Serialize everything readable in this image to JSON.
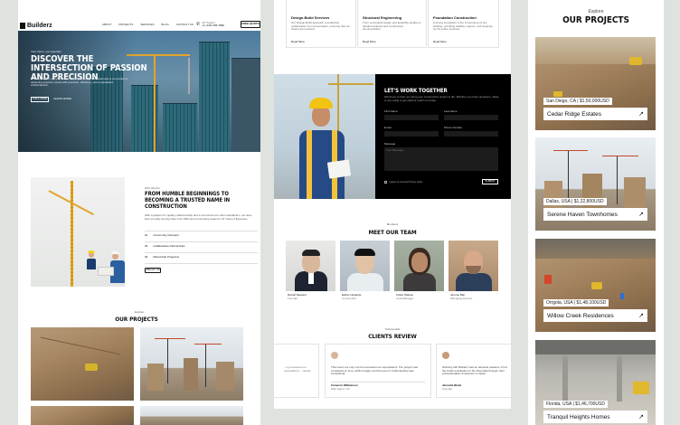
{
  "home": {
    "logo": "Builderz",
    "nav": [
      "ABOUT",
      "PROJECTS",
      "SERVICES",
      "BLOG",
      "CONTACT US"
    ],
    "support_label": "24/7 Support",
    "phone": "+1 (123) 456-7890",
    "cta": "FREE QUOTE",
    "hero": {
      "eyebrow": "Your vision, our expertise",
      "title": "DISCOVER THE INTERSECTION OF PASSION AND PRECISION",
      "desc": "From concept to completion, our dedicated team of professionals is committed to delivering superior results with precision, efficiency, and unparalleled craftsmanship.",
      "btn_primary": "CALL NOW",
      "btn_secondary": "LEARN MORE"
    },
    "about": {
      "eyebrow": "Who We Are",
      "title": "FROM HUMBLE BEGINNINGS TO BECOMING A TRUSTED NAME IN CONSTRUCTION",
      "desc": "With a passion for quality craftsmanship and a commitment to client satisfaction, we have been proudly serving New York 1026 and surrounding areas for 13 Years of Expertise.",
      "list": [
        {
          "num": "01",
          "label": "Community Outreach"
        },
        {
          "num": "02",
          "label": "Collaborative Partnerships"
        },
        {
          "num": "03",
          "label": "Mentorship Programs"
        }
      ],
      "btn": "ABOUT US"
    },
    "projects": {
      "eyebrow": "Explore",
      "title": "OUR PROJECTS"
    }
  },
  "services_page": {
    "services": [
      {
        "title": "Design-Build Services",
        "desc": "Our Design-Build approach emphasizes collaboration & communication, ensuring that our clients are involved.",
        "link": "Read More"
      },
      {
        "title": "Structural Engineering",
        "desc": "From conceptual design and feasibility studies to detailed analysis and construction documentation.",
        "link": "Read More"
      },
      {
        "title": "Foundation Construction",
        "desc": "A strong foundation is the cornerstone of any building, providing stability, support, and longevity for the entire structure.",
        "link": "Read More"
      }
    ],
    "form": {
      "title": "LET'S WORK TOGETHER",
      "desc": "We'd love to hear you bring your construction project to life. Whether you have questions, ideas, or are ready to get started, reach out today.",
      "first_name": "First Name",
      "last_name": "Last Name",
      "email": "Email",
      "phone": "Phone Number",
      "message": "Message",
      "message_placeholder": "Your Message...",
      "consent": "I agree to General Privacy policy",
      "submit": "SUBMIT"
    },
    "team": {
      "eyebrow": "Members",
      "title": "MEET OUR TEAM",
      "members": [
        {
          "name": "Darrell Steward",
          "role": "Founder"
        },
        {
          "name": "Esther Howards",
          "role": "Co-Founder"
        },
        {
          "name": "Kristin Watson",
          "role": "Lead Manager"
        },
        {
          "name": "Jerome Bell",
          "role": "Managing Director"
        }
      ]
    },
    "testimonials": {
      "eyebrow": "Testimonials",
      "title": "CLIENTS REVIEW",
      "left_quote": "...ng exceeded our expectations, ...quired.",
      "main_quote": "Their team not only met but exceeded our expectations. The project was completed on time, within budget, and the level of craftsmanship was exceptional.",
      "main_name": "Cameron Williamson",
      "main_role": "Web Agent, US",
      "right_quote": "Working with Builderz was an absolute pleasure. From the initial consultation to the final walk-through, their professionalism & attention to detail.",
      "right_name": "Jennette Black",
      "right_role": "Founder"
    }
  },
  "projects_page": {
    "eyebrow": "Explore",
    "title": "OUR PROJECTS",
    "items": [
      {
        "location": "San Diego, CA",
        "price": "$1,50,000USD",
        "name": "Cedar Ridge Estates"
      },
      {
        "location": "Dallas, USA",
        "price": "$1,22,800USD",
        "name": "Serene Haven Townhomes"
      },
      {
        "location": "Orrgola, USA",
        "price": "$1,48,100USD",
        "name": "Willow Creek Residences"
      },
      {
        "location": "Florida, USA",
        "price": "$1,46,700USD",
        "name": "Tranquil Heights Homes"
      }
    ]
  }
}
